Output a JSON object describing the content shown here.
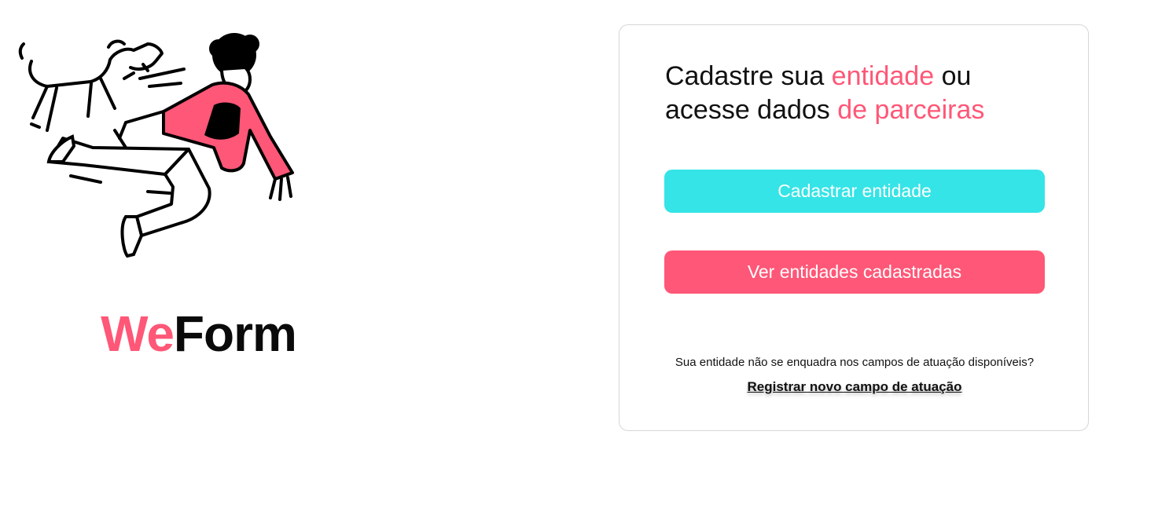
{
  "brand": {
    "part1": "We",
    "part2": "Form"
  },
  "card": {
    "headline": {
      "t1": "Cadastre sua ",
      "t2": "entidade",
      "t3": " ou",
      "t4": "acesse dados ",
      "t5": "de parceiras"
    },
    "register_button": "Cadastrar entidade",
    "view_button": "Ver entidades cadastradas",
    "help_text": "Sua entidade não se enquadra nos campos de atuação disponíveis?",
    "help_link": "Registrar novo campo de atuação"
  },
  "colors": {
    "accent_pink": "#FF5777",
    "accent_cyan": "#35E4E6",
    "text": "#111111",
    "card_border": "#d6d6d6"
  },
  "icons": {
    "illustration": "running-person-with-dog-illustration"
  }
}
